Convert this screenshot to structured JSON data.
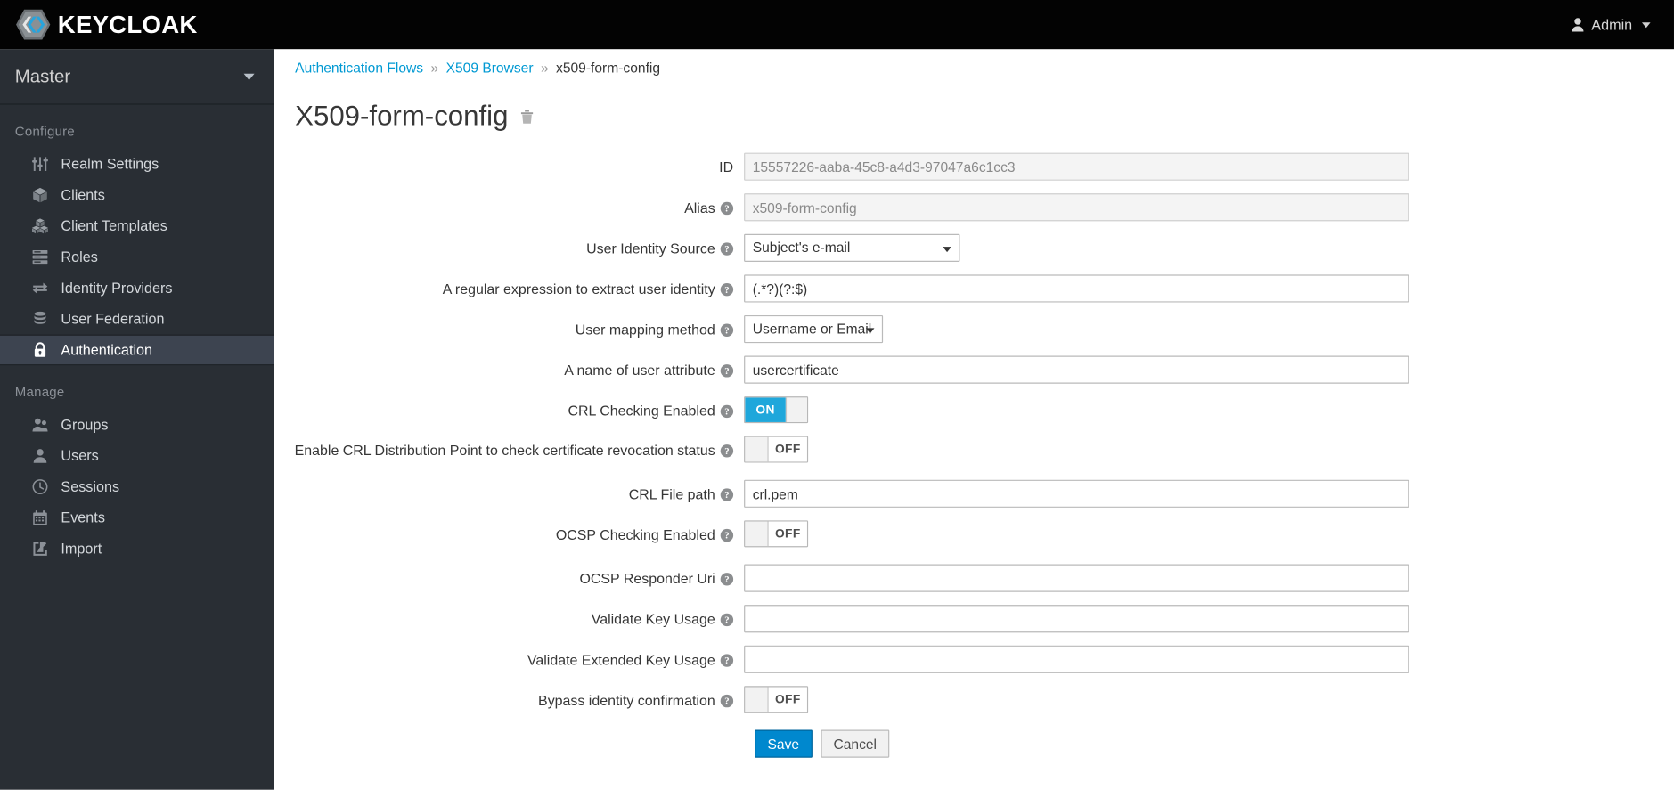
{
  "topbar": {
    "brand": "KEYCLOAK",
    "user_label": "Admin"
  },
  "sidebar": {
    "realm": "Master",
    "groups": [
      {
        "title": "Configure",
        "items": [
          {
            "label": "Realm Settings",
            "icon": "sliders-icon",
            "active": false
          },
          {
            "label": "Clients",
            "icon": "cube-icon",
            "active": false
          },
          {
            "label": "Client Templates",
            "icon": "cubes-icon",
            "active": false
          },
          {
            "label": "Roles",
            "icon": "list-icon",
            "active": false
          },
          {
            "label": "Identity Providers",
            "icon": "exchange-icon",
            "active": false
          },
          {
            "label": "User Federation",
            "icon": "database-icon",
            "active": false
          },
          {
            "label": "Authentication",
            "icon": "lock-icon",
            "active": true
          }
        ]
      },
      {
        "title": "Manage",
        "items": [
          {
            "label": "Groups",
            "icon": "users-icon",
            "active": false
          },
          {
            "label": "Users",
            "icon": "user-icon",
            "active": false
          },
          {
            "label": "Sessions",
            "icon": "clock-icon",
            "active": false
          },
          {
            "label": "Events",
            "icon": "calendar-icon",
            "active": false
          },
          {
            "label": "Import",
            "icon": "import-arrow-icon",
            "active": false
          }
        ]
      }
    ]
  },
  "breadcrumb": {
    "items": [
      {
        "label": "Authentication Flows",
        "link": true
      },
      {
        "label": "X509 Browser",
        "link": true
      },
      {
        "label": "x509-form-config",
        "link": false
      }
    ],
    "separator": "»"
  },
  "page": {
    "title": "X509-form-config",
    "delete_icon": "trash-icon"
  },
  "form": {
    "help_glyph": "?",
    "fields": [
      {
        "name": "id",
        "label": "ID",
        "has_help": false,
        "type": "text",
        "value": "15557226-aaba-45c8-a4d3-97047a6c1cc3",
        "readonly": true
      },
      {
        "name": "alias",
        "label": "Alias",
        "has_help": true,
        "type": "text",
        "value": "x509-form-config",
        "readonly": true
      },
      {
        "name": "user-identity-source",
        "label": "User Identity Source",
        "has_help": true,
        "type": "select",
        "value": "Subject's e-mail",
        "width": "w-ident"
      },
      {
        "name": "user-identity-regex",
        "label": "A regular expression to extract user identity",
        "has_help": true,
        "type": "text",
        "value": "(.*?)(?:$)",
        "readonly": false
      },
      {
        "name": "user-mapping-method",
        "label": "User mapping method",
        "has_help": true,
        "type": "select",
        "value": "Username or Email",
        "width": "w-map"
      },
      {
        "name": "user-attribute-name",
        "label": "A name of user attribute",
        "has_help": true,
        "type": "text",
        "value": "usercertificate",
        "readonly": false
      },
      {
        "name": "crl-checking-enabled",
        "label": "CRL Checking Enabled",
        "has_help": true,
        "type": "toggle",
        "value": "ON"
      },
      {
        "name": "crl-distribution-point-enabled",
        "label": "Enable CRL Distribution Point to check certificate revocation status",
        "has_help": true,
        "type": "toggle",
        "value": "OFF"
      },
      {
        "name": "crl-file-path",
        "label": "CRL File path",
        "has_help": true,
        "type": "text",
        "value": "crl.pem",
        "readonly": false
      },
      {
        "name": "ocsp-checking-enabled",
        "label": "OCSP Checking Enabled",
        "has_help": true,
        "type": "toggle",
        "value": "OFF"
      },
      {
        "name": "ocsp-responder-uri",
        "label": "OCSP Responder Uri",
        "has_help": true,
        "type": "text",
        "value": "",
        "readonly": false
      },
      {
        "name": "validate-key-usage",
        "label": "Validate Key Usage",
        "has_help": true,
        "type": "text",
        "value": "",
        "readonly": false
      },
      {
        "name": "validate-extended-key-usage",
        "label": "Validate Extended Key Usage",
        "has_help": true,
        "type": "text",
        "value": "",
        "readonly": false
      },
      {
        "name": "bypass-identity-confirmation",
        "label": "Bypass identity confirmation",
        "has_help": true,
        "type": "toggle",
        "value": "OFF"
      }
    ],
    "buttons": [
      {
        "name": "save-button",
        "label": "Save",
        "style": "primary"
      },
      {
        "name": "cancel-button",
        "label": "Cancel",
        "style": "default"
      }
    ]
  },
  "colors": {
    "toggle_on": "#1fa7db",
    "link": "#0099d3",
    "sidebar_bg": "#292e34",
    "sidebar_active": "#3d4450",
    "topbar_bg": "#030303",
    "brand_accent": "#27a4dd"
  }
}
